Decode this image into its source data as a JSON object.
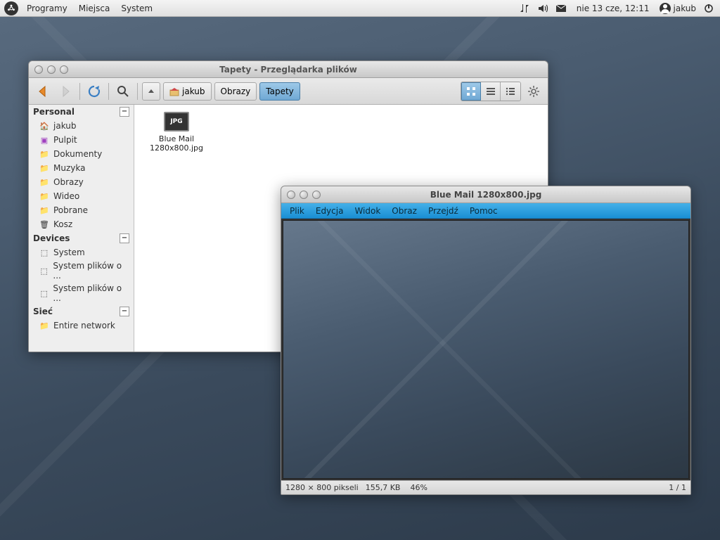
{
  "panel": {
    "menus": [
      "Programy",
      "Miejsca",
      "System"
    ],
    "clock": "nie 13 cze, 12:11",
    "user": "jakub"
  },
  "file_browser": {
    "title": "Tapety - Przeglądarka plików",
    "path": [
      "jakub",
      "Obrazy",
      "Tapety"
    ],
    "active_path_index": 2,
    "sidebar": {
      "sections": [
        {
          "label": "Personal",
          "items": [
            {
              "icon": "home",
              "label": "jakub"
            },
            {
              "icon": "desktop",
              "label": "Pulpit"
            },
            {
              "icon": "folder",
              "label": "Dokumenty"
            },
            {
              "icon": "music",
              "label": "Muzyka"
            },
            {
              "icon": "pictures",
              "label": "Obrazy"
            },
            {
              "icon": "video",
              "label": "Wideo"
            },
            {
              "icon": "download",
              "label": "Pobrane"
            },
            {
              "icon": "trash",
              "label": "Kosz"
            }
          ]
        },
        {
          "label": "Devices",
          "items": [
            {
              "icon": "disk",
              "label": "System"
            },
            {
              "icon": "disk",
              "label": "System plików o ..."
            },
            {
              "icon": "disk",
              "label": "System plików o ..."
            }
          ]
        },
        {
          "label": "Sieć",
          "items": [
            {
              "icon": "network",
              "label": "Entire network"
            }
          ]
        }
      ]
    },
    "files": [
      {
        "thumb_label": "JPG",
        "name": "Blue Mail 1280x800.jpg"
      }
    ]
  },
  "image_viewer": {
    "title": "Blue Mail 1280x800.jpg",
    "menus": [
      "Plik",
      "Edycja",
      "Widok",
      "Obraz",
      "Przejdź",
      "Pomoc"
    ],
    "status": {
      "dimensions": "1280 × 800 pikseli",
      "size": "155,7 KB",
      "zoom": "46%",
      "page": "1 / 1"
    }
  }
}
